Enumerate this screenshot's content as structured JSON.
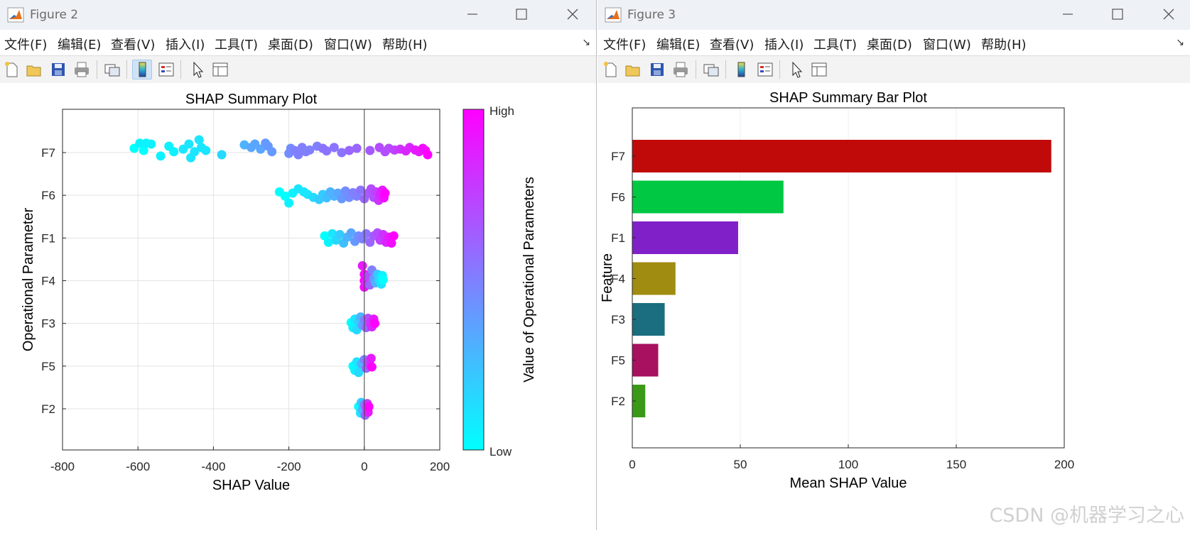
{
  "figure2": {
    "window_title": "Figure 2",
    "menu": [
      "文件(F)",
      "编辑(E)",
      "查看(V)",
      "插入(I)",
      "工具(T)",
      "桌面(D)",
      "窗口(W)",
      "帮助(H)"
    ],
    "toolbar_icons": [
      "new-figure-icon",
      "open-file-icon",
      "save-icon",
      "print-icon",
      "link-plot-icon",
      "colorbar-icon",
      "legend-icon",
      "pointer-icon",
      "property-inspector-icon"
    ],
    "chart_data": {
      "type": "scatter",
      "title": "SHAP Summary Plot",
      "xlabel": "SHAP Value",
      "ylabel": "Operational Parameter",
      "xlim": [
        -800,
        200
      ],
      "xticks": [
        -800,
        -600,
        -400,
        -200,
        0,
        200
      ],
      "categories": [
        "F2",
        "F5",
        "F3",
        "F4",
        "F1",
        "F6",
        "F7"
      ],
      "grid": true,
      "colorbar": {
        "label": "Value of Operational Parameters",
        "high_label": "High",
        "low_label": "Low",
        "low_color": "#00ffff",
        "high_color": "#ff00ff"
      },
      "series": [
        {
          "feature": "F7",
          "points": [
            [
              -610,
              0.1,
              0.0
            ],
            [
              -595,
              0.22,
              0.05
            ],
            [
              -585,
              0.05,
              0.0
            ],
            [
              -578,
              0.22,
              0.05
            ],
            [
              -565,
              0.2,
              0.05
            ],
            [
              -540,
              -0.08,
              0.05
            ],
            [
              -518,
              0.15,
              0.05
            ],
            [
              -505,
              0.02,
              0.05
            ],
            [
              -480,
              0.08,
              0.1
            ],
            [
              -465,
              0.2,
              0.1
            ],
            [
              -460,
              -0.12,
              0.1
            ],
            [
              -450,
              0.02,
              0.1
            ],
            [
              -438,
              0.3,
              0.1
            ],
            [
              -432,
              0.12,
              0.1
            ],
            [
              -420,
              0.05,
              0.1
            ],
            [
              -378,
              -0.05,
              0.15
            ],
            [
              -318,
              0.18,
              0.3
            ],
            [
              -300,
              0.12,
              0.35
            ],
            [
              -290,
              0.2,
              0.35
            ],
            [
              -275,
              0.08,
              0.35
            ],
            [
              -262,
              0.22,
              0.4
            ],
            [
              -255,
              0.15,
              0.4
            ],
            [
              -245,
              0.02,
              0.4
            ],
            [
              -200,
              -0.02,
              0.45
            ],
            [
              -195,
              0.1,
              0.45
            ],
            [
              -185,
              0.05,
              0.5
            ],
            [
              -175,
              -0.05,
              0.5
            ],
            [
              -165,
              0.12,
              0.5
            ],
            [
              -155,
              0.02,
              0.5
            ],
            [
              -145,
              0.06,
              0.5
            ],
            [
              -125,
              0.15,
              0.5
            ],
            [
              -110,
              0.1,
              0.55
            ],
            [
              -100,
              0.04,
              0.55
            ],
            [
              -80,
              0.12,
              0.55
            ],
            [
              -60,
              0.0,
              0.55
            ],
            [
              -40,
              0.05,
              0.6
            ],
            [
              -20,
              0.1,
              0.6
            ],
            [
              15,
              0.05,
              0.65
            ],
            [
              40,
              0.12,
              0.7
            ],
            [
              55,
              0.02,
              0.7
            ],
            [
              65,
              0.1,
              0.7
            ],
            [
              80,
              0.06,
              0.75
            ],
            [
              95,
              0.08,
              0.8
            ],
            [
              110,
              0.04,
              0.85
            ],
            [
              120,
              0.12,
              0.85
            ],
            [
              135,
              0.06,
              0.9
            ],
            [
              145,
              0.02,
              0.9
            ],
            [
              155,
              0.1,
              0.95
            ],
            [
              162,
              0.05,
              0.95
            ],
            [
              168,
              -0.05,
              1.0
            ]
          ]
        },
        {
          "feature": "F6",
          "points": [
            [
              -225,
              0.08,
              0.0
            ],
            [
              -210,
              -0.02,
              0.0
            ],
            [
              -200,
              -0.18,
              0.05
            ],
            [
              -190,
              0.05,
              0.05
            ],
            [
              -175,
              0.15,
              0.1
            ],
            [
              -160,
              0.08,
              0.1
            ],
            [
              -150,
              0.02,
              0.1
            ],
            [
              -135,
              -0.05,
              0.15
            ],
            [
              -120,
              -0.1,
              0.2
            ],
            [
              -110,
              0.02,
              0.2
            ],
            [
              -100,
              -0.06,
              0.25
            ],
            [
              -90,
              0.08,
              0.3
            ],
            [
              -80,
              -0.02,
              0.3
            ],
            [
              -70,
              0.05,
              0.35
            ],
            [
              -60,
              -0.08,
              0.4
            ],
            [
              -50,
              0.1,
              0.45
            ],
            [
              -40,
              -0.05,
              0.45
            ],
            [
              -30,
              0.06,
              0.5
            ],
            [
              -20,
              -0.02,
              0.5
            ],
            [
              -10,
              0.12,
              0.55
            ],
            [
              0,
              -0.08,
              0.6
            ],
            [
              10,
              0.05,
              0.65
            ],
            [
              18,
              0.15,
              0.7
            ],
            [
              25,
              -0.05,
              0.7
            ],
            [
              32,
              0.08,
              0.75
            ],
            [
              38,
              -0.12,
              0.8
            ],
            [
              42,
              0.02,
              0.85
            ],
            [
              48,
              0.12,
              0.9
            ],
            [
              52,
              -0.06,
              0.95
            ],
            [
              55,
              0.05,
              1.0
            ]
          ]
        },
        {
          "feature": "F1",
          "points": [
            [
              -105,
              0.05,
              0.0
            ],
            [
              -95,
              -0.1,
              0.05
            ],
            [
              -85,
              0.1,
              0.1
            ],
            [
              -75,
              -0.05,
              0.15
            ],
            [
              -65,
              0.08,
              0.2
            ],
            [
              -55,
              -0.12,
              0.25
            ],
            [
              -45,
              0.02,
              0.3
            ],
            [
              -35,
              0.12,
              0.35
            ],
            [
              -25,
              -0.08,
              0.4
            ],
            [
              -15,
              0.05,
              0.45
            ],
            [
              -5,
              -0.02,
              0.5
            ],
            [
              5,
              0.1,
              0.55
            ],
            [
              15,
              -0.1,
              0.6
            ],
            [
              25,
              0.05,
              0.65
            ],
            [
              35,
              0.12,
              0.7
            ],
            [
              42,
              -0.05,
              0.75
            ],
            [
              50,
              0.08,
              0.8
            ],
            [
              58,
              -0.1,
              0.85
            ],
            [
              65,
              0.02,
              0.9
            ],
            [
              72,
              -0.12,
              0.95
            ],
            [
              78,
              0.05,
              1.0
            ]
          ]
        },
        {
          "feature": "F4",
          "points": [
            [
              -5,
              0.35,
              0.9
            ],
            [
              0,
              0.15,
              0.95
            ],
            [
              0,
              0.0,
              1.0
            ],
            [
              0,
              -0.15,
              0.95
            ],
            [
              5,
              -0.05,
              0.85
            ],
            [
              10,
              0.1,
              0.7
            ],
            [
              15,
              -0.1,
              0.6
            ],
            [
              20,
              0.25,
              0.5
            ],
            [
              25,
              0.05,
              0.4
            ],
            [
              30,
              -0.05,
              0.3
            ],
            [
              35,
              0.15,
              0.2
            ],
            [
              40,
              0.0,
              0.15
            ],
            [
              45,
              -0.08,
              0.1
            ],
            [
              48,
              0.12,
              0.05
            ],
            [
              50,
              0.02,
              0.0
            ]
          ]
        },
        {
          "feature": "F3",
          "points": [
            [
              -35,
              0.02,
              0.0
            ],
            [
              -30,
              -0.1,
              0.05
            ],
            [
              -25,
              0.1,
              0.1
            ],
            [
              -20,
              -0.15,
              0.15
            ],
            [
              -15,
              0.05,
              0.2
            ],
            [
              -10,
              0.15,
              0.3
            ],
            [
              -5,
              -0.05,
              0.4
            ],
            [
              0,
              0.08,
              0.5
            ],
            [
              5,
              -0.1,
              0.6
            ],
            [
              10,
              0.12,
              0.7
            ],
            [
              15,
              0.0,
              0.8
            ],
            [
              20,
              -0.08,
              0.85
            ],
            [
              25,
              0.1,
              0.9
            ],
            [
              28,
              0.0,
              1.0
            ]
          ]
        },
        {
          "feature": "F5",
          "points": [
            [
              -30,
              0.0,
              0.0
            ],
            [
              -25,
              -0.1,
              0.05
            ],
            [
              -20,
              0.1,
              0.1
            ],
            [
              -15,
              -0.15,
              0.15
            ],
            [
              -8,
              0.05,
              0.3
            ],
            [
              0,
              0.15,
              0.5
            ],
            [
              5,
              -0.05,
              0.6
            ],
            [
              10,
              0.1,
              0.7
            ],
            [
              15,
              0.02,
              0.8
            ],
            [
              18,
              0.18,
              0.9
            ],
            [
              20,
              -0.02,
              1.0
            ]
          ]
        },
        {
          "feature": "F2",
          "points": [
            [
              -15,
              0.05,
              0.0
            ],
            [
              -10,
              -0.1,
              0.1
            ],
            [
              -8,
              0.15,
              0.2
            ],
            [
              -5,
              -0.02,
              0.3
            ],
            [
              0,
              0.1,
              0.5
            ],
            [
              2,
              -0.15,
              0.6
            ],
            [
              5,
              0.02,
              0.7
            ],
            [
              8,
              0.12,
              0.8
            ],
            [
              10,
              -0.08,
              0.9
            ],
            [
              12,
              0.05,
              1.0
            ]
          ]
        }
      ]
    }
  },
  "figure3": {
    "window_title": "Figure 3",
    "menu": [
      "文件(F)",
      "编辑(E)",
      "查看(V)",
      "插入(I)",
      "工具(T)",
      "桌面(D)",
      "窗口(W)",
      "帮助(H)"
    ],
    "toolbar_icons": [
      "new-figure-icon",
      "open-file-icon",
      "save-icon",
      "print-icon",
      "link-plot-icon",
      "colorbar-icon",
      "legend-icon",
      "pointer-icon",
      "property-inspector-icon"
    ],
    "chart_data": {
      "type": "bar",
      "orientation": "horizontal",
      "title": "SHAP Summary Bar Plot",
      "xlabel": "Mean SHAP Value",
      "ylabel": "Feature",
      "xlim": [
        0,
        200
      ],
      "xticks": [
        0,
        50,
        100,
        150,
        200
      ],
      "categories": [
        "F7",
        "F6",
        "F1",
        "F4",
        "F3",
        "F5",
        "F2"
      ],
      "values": [
        194,
        70,
        49,
        20,
        15,
        12,
        6
      ],
      "colors": [
        "#c00a0a",
        "#00c842",
        "#8020c8",
        "#a08c10",
        "#1a6e80",
        "#a81060",
        "#3a9a18"
      ],
      "grid": true
    }
  },
  "watermark": "CSDN @机器学习之心"
}
